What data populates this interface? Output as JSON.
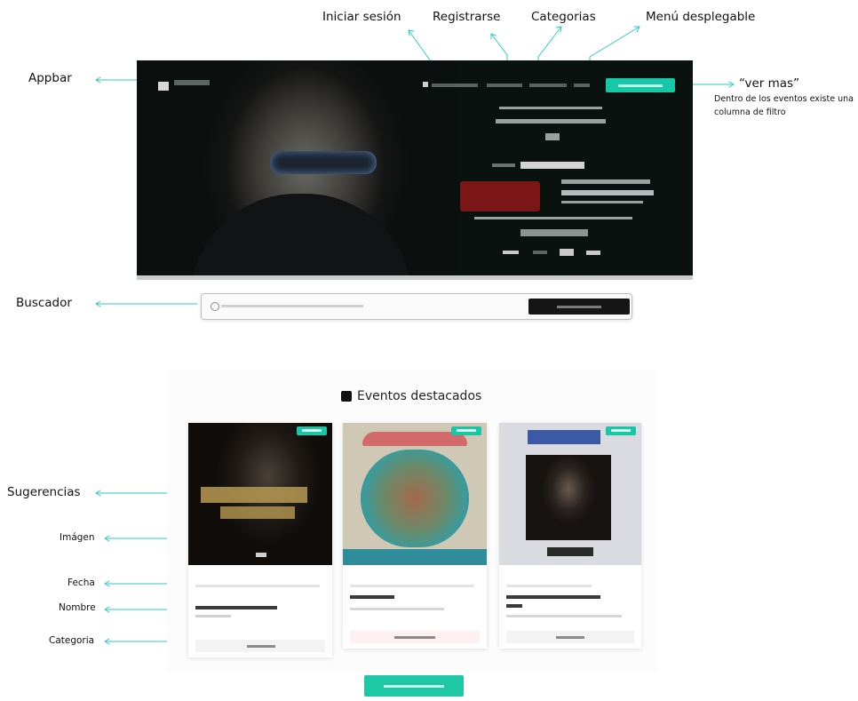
{
  "annotations": {
    "iniciar_sesion": "Iniciar sesión",
    "registrarse": "Registrarse",
    "categorias": "Categorias",
    "menu_desplegable": "Menú desplegable",
    "appbar": "Appbar",
    "ver_mas": "“ver mas”",
    "ver_mas_note": "Dentro de los eventos existe una columna de filtro",
    "buscador": "Buscador",
    "sugerencias": "Sugerencias",
    "imagen": "Imágen",
    "fecha": "Fecha",
    "nombre": "Nombre",
    "categoria": "Categoria"
  },
  "colors": {
    "accent": "#1ec8a6",
    "arrow": "#2ec9c1",
    "hero_bg": "#0a1210",
    "search_button": "#161616"
  },
  "mockup": {
    "events_title": "Eventos destacados"
  }
}
